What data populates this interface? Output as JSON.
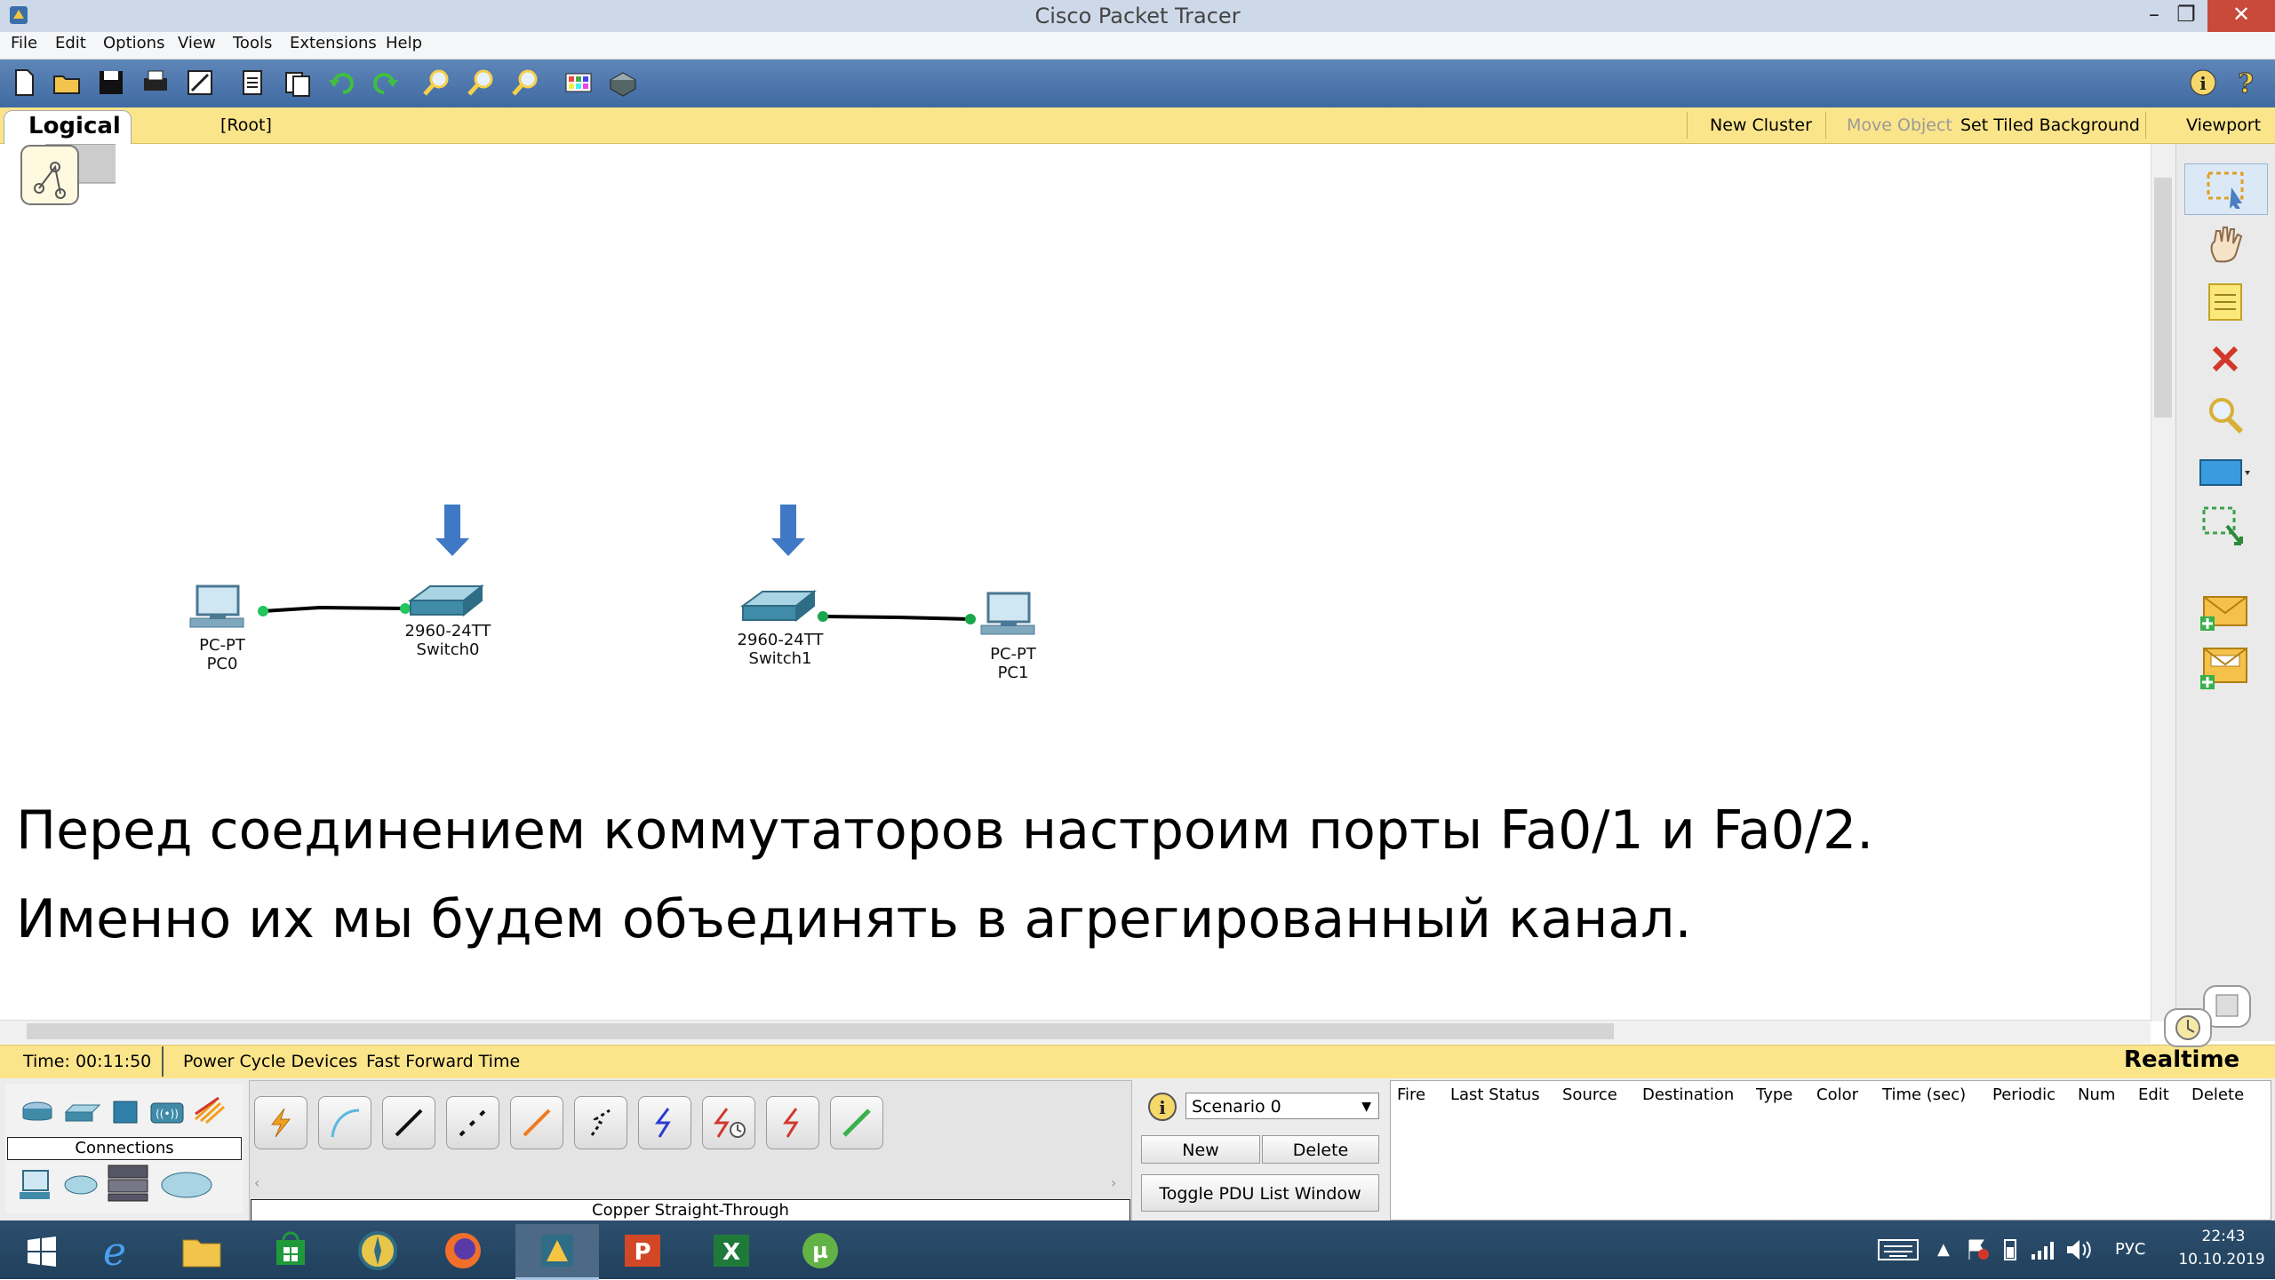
{
  "window": {
    "title": "Cisco Packet Tracer"
  },
  "menu": [
    "File",
    "Edit",
    "Options",
    "View",
    "Tools",
    "Extensions",
    "Help"
  ],
  "toolbar_icons": [
    "new-file-icon",
    "open-folder-icon",
    "save-icon",
    "print-icon",
    "activity-wizard-icon",
    "copy-icon",
    "paste-icon",
    "undo-icon",
    "redo-icon",
    "zoom-in-icon",
    "zoom-reset-icon",
    "zoom-out-icon",
    "palette-icon",
    "custom-device-icon",
    "info-icon",
    "help-icon"
  ],
  "logical_bar": {
    "tab_label": "Logical",
    "root_label": "[Root]",
    "new_cluster": "New Cluster",
    "move_object": "Move Object",
    "set_tiled_background": "Set Tiled Background",
    "viewport": "Viewport"
  },
  "devices": [
    {
      "type": "PC-PT",
      "name": "PC0"
    },
    {
      "type": "2960-24TT",
      "name": "Switch0"
    },
    {
      "type": "2960-24TT",
      "name": "Switch1"
    },
    {
      "type": "PC-PT",
      "name": "PC1"
    }
  ],
  "slide_text": {
    "line1": "Перед соединением коммутаторов настроим порты Fa0/1 и Fa0/2.",
    "line2": "Именно их мы будем объединять в агрегированный канал."
  },
  "status_bar": {
    "time": "Time: 00:11:50",
    "power_cycle": "Power Cycle Devices",
    "fast_forward": "Fast Forward Time",
    "mode": "Realtime"
  },
  "device_panel": {
    "category_label": "Connections",
    "selected_cable": "Copper Straight-Through"
  },
  "scenario": {
    "selected": "Scenario 0",
    "new_button": "New",
    "delete_button": "Delete",
    "toggle_button": "Toggle PDU List Window"
  },
  "pdu_columns": [
    "Fire",
    "Last Status",
    "Source",
    "Destination",
    "Type",
    "Color",
    "Time (sec)",
    "Periodic",
    "Num",
    "Edit",
    "Delete"
  ],
  "taskbar": {
    "lang": "РУС",
    "time": "22:43",
    "date": "10.10.2019"
  },
  "colors": {
    "logical_bar": "#fbe58b",
    "toolbar": "#4a74ab",
    "link": "#000000",
    "port_up": "#22c55e",
    "arrow": "#3f78c4"
  }
}
